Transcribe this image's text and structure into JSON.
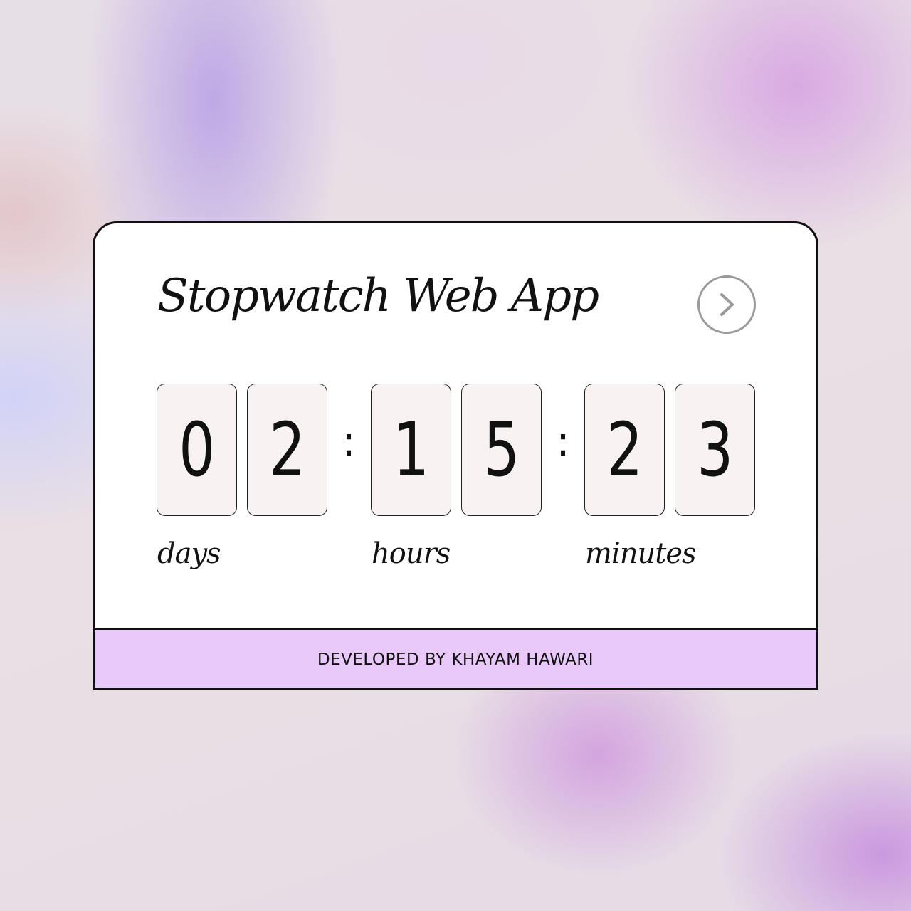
{
  "app": {
    "title": "Stopwatch Web App"
  },
  "header": {
    "next_icon": "chevron-right-icon"
  },
  "timer": {
    "days": [
      "0",
      "2"
    ],
    "hours": [
      "1",
      "5"
    ],
    "minutes": [
      "2",
      "3"
    ],
    "separator": ":",
    "labels": {
      "days": "days",
      "hours": "hours",
      "minutes": "minutes"
    }
  },
  "footer": {
    "credit": "DEVELOPED BY KHAYAM HAWARI"
  },
  "colors": {
    "card_background": "#ffffff",
    "digit_background": "#f8f3f2",
    "footer_background": "#e9c8fa",
    "border": "#111111"
  }
}
